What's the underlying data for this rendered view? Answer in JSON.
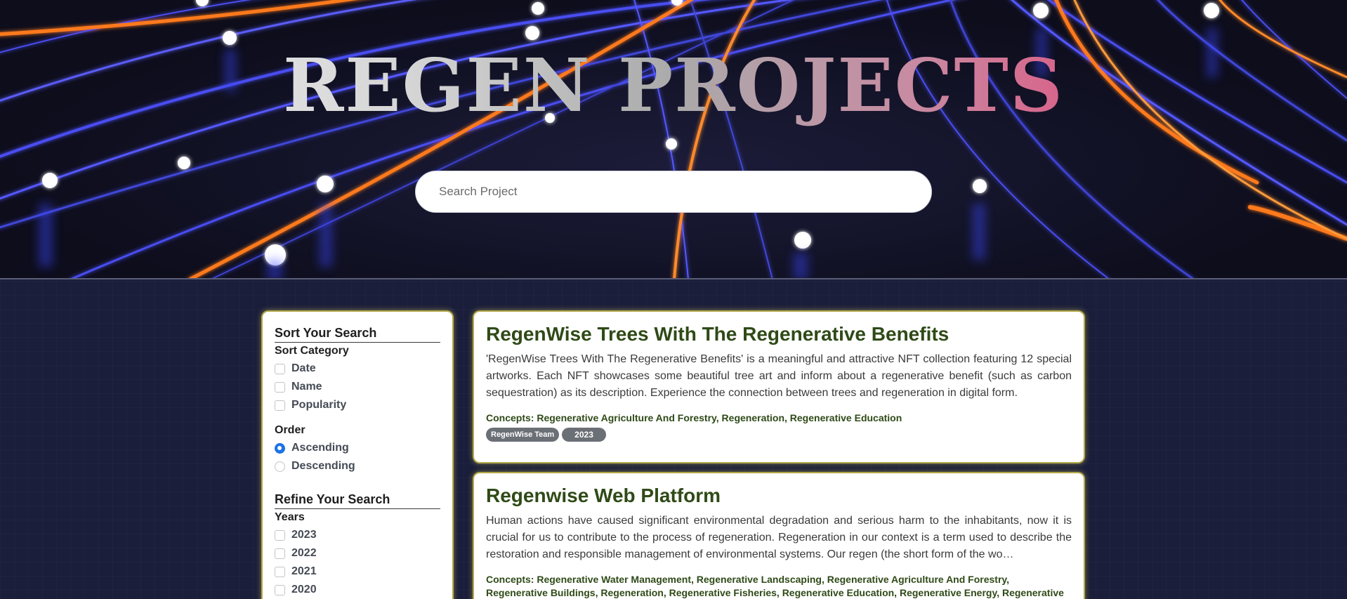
{
  "hero": {
    "title": "REGEN PROJECTS",
    "search_placeholder": "Search Project"
  },
  "sidebar": {
    "sort_heading": "Sort Your Search",
    "sort_category_label": "Sort Category",
    "sort_options": [
      {
        "label": "Date",
        "checked": false
      },
      {
        "label": "Name",
        "checked": false
      },
      {
        "label": "Popularity",
        "checked": false
      }
    ],
    "order_label": "Order",
    "order_options": [
      {
        "label": "Ascending",
        "selected": true
      },
      {
        "label": "Descending",
        "selected": false
      }
    ],
    "refine_heading": "Refine Your Search",
    "years_label": "Years",
    "years": [
      {
        "label": "2023",
        "checked": false
      },
      {
        "label": "2022",
        "checked": false
      },
      {
        "label": "2021",
        "checked": false
      },
      {
        "label": "2020",
        "checked": false
      }
    ]
  },
  "projects": [
    {
      "title": "RegenWise Trees With The Regenerative Benefits",
      "description": "'RegenWise Trees With The Regenerative Benefits' is a meaningful and attractive NFT collection featuring 12 special artworks. Each NFT showcases some beautiful tree art and inform about a regenerative benefit (such as carbon sequestration) as its description. Experience the connection between trees and regeneration in digital form.",
      "concepts": "Concepts: Regenerative Agriculture And Forestry, Regeneration, Regenerative Education",
      "team": "RegenWise Team",
      "year": "2023"
    },
    {
      "title": "Regenwise Web Platform",
      "description": "Human actions have caused significant environmental degradation and serious harm to the inhabitants, now it is crucial for us to contribute to the process of regeneration. Regeneration in our context is a term used to describe the restoration and responsible management of environmental systems. Our regen (the short form of the wo…",
      "concepts": "Concepts: Regenerative Water Management, Regenerative Landscaping, Regenerative Agriculture And Forestry, Regenerative Buildings, Regeneration, Regenerative Fisheries, Regenerative Education, Regenerative Energy, Regenerative Waste Management"
    }
  ],
  "colors": {
    "accent_green": "#2f4a17",
    "card_glow": "#b5a94a",
    "page_bg": "#1a1e3a",
    "radio_blue": "#1a73e8"
  }
}
